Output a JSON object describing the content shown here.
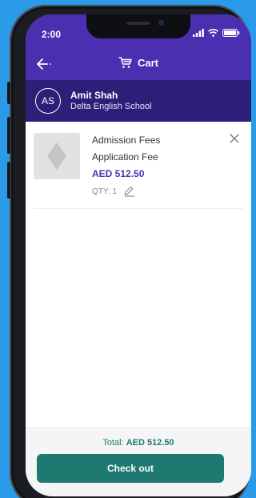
{
  "status": {
    "time": "2:00"
  },
  "nav": {
    "title": "Cart"
  },
  "user": {
    "initials": "AS",
    "name": "Amit Shah",
    "school": "Delta English School"
  },
  "cart": {
    "items": [
      {
        "name": "Admission Fees",
        "description": "Application Fee",
        "price": "AED 512.50",
        "qty_label": "QTY: 1"
      }
    ]
  },
  "footer": {
    "total_label": "Total:",
    "total_value": "AED 512.50",
    "checkout_label": "Check out"
  },
  "colors": {
    "header": "#4a2fb0",
    "user_bar": "#2d1e7a",
    "accent": "#1e7a70",
    "background": "#2b9ae8"
  }
}
